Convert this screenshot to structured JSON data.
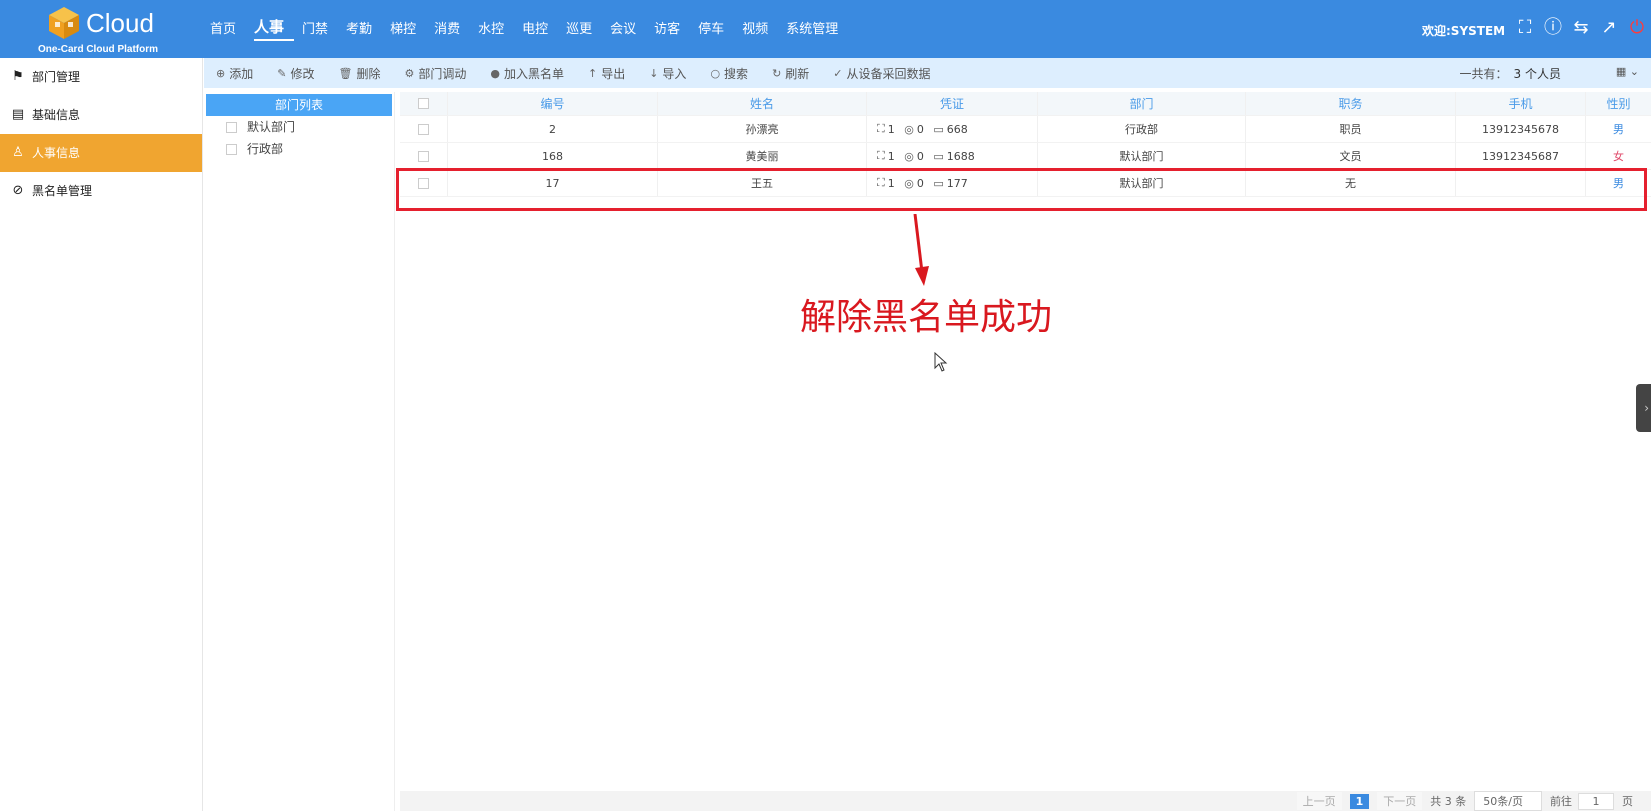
{
  "header": {
    "brand": "Cloud",
    "subtitle": "One-Card Cloud Platform",
    "nav": [
      "首页",
      "人事",
      "门禁",
      "考勤",
      "梯控",
      "消费",
      "水控",
      "电控",
      "巡更",
      "会议",
      "访客",
      "停车",
      "视频",
      "系统管理"
    ],
    "active_nav": "人事",
    "welcome": "欢迎:SYSTEM",
    "icons": [
      "fullscreen-icon",
      "help-icon",
      "language-icon",
      "external-link-icon",
      "power-icon"
    ]
  },
  "sidebar": {
    "items": [
      {
        "label": "部门管理",
        "icon": "org-icon"
      },
      {
        "label": "基础信息",
        "icon": "document-icon"
      },
      {
        "label": "人事信息",
        "icon": "person-icon"
      },
      {
        "label": "黑名单管理",
        "icon": "blacklist-icon"
      }
    ],
    "active_index": 2
  },
  "toolbar": {
    "buttons": [
      {
        "label": "添加",
        "icon": "⊕"
      },
      {
        "label": "修改",
        "icon": "✎"
      },
      {
        "label": "删除",
        "icon": "🗑"
      },
      {
        "label": "部门调动",
        "icon": "⚙"
      },
      {
        "label": "加入黑名单",
        "icon": "●"
      },
      {
        "label": "导出",
        "icon": "↑"
      },
      {
        "label": "导入",
        "icon": "↓"
      },
      {
        "label": "搜索",
        "icon": "○"
      },
      {
        "label": "刷新",
        "icon": "↻"
      },
      {
        "label": "从设备采回数据",
        "icon": "✓"
      }
    ],
    "total_label": "一共有：",
    "total_value": "3 个人员"
  },
  "dept_panel": {
    "title": "部门列表",
    "items": [
      "默认部门",
      "行政部"
    ]
  },
  "table": {
    "headers": [
      "编号",
      "姓名",
      "凭证",
      "部门",
      "职务",
      "手机",
      "性别"
    ],
    "rows": [
      {
        "id": "2",
        "name": "孙漂亮",
        "face": "1",
        "finger": "0",
        "card": "668",
        "dept": "行政部",
        "title": "职员",
        "phone": "13912345678",
        "gender": "男"
      },
      {
        "id": "168",
        "name": "黄美丽",
        "face": "1",
        "finger": "0",
        "card": "1688",
        "dept": "默认部门",
        "title": "文员",
        "phone": "13912345687",
        "gender": "女"
      },
      {
        "id": "17",
        "name": "王五",
        "face": "1",
        "finger": "0",
        "card": "177",
        "dept": "默认部门",
        "title": "无",
        "phone": "",
        "gender": "男"
      }
    ]
  },
  "annotation": {
    "text": "解除黑名单成功",
    "color": "#d9181f"
  },
  "pager": {
    "prev": "上一页",
    "current": "1",
    "next": "下一页",
    "total": "共 3 条",
    "page_size": "50条/页",
    "goto_label": "前往",
    "goto_value": "1",
    "page_suffix": "页"
  }
}
